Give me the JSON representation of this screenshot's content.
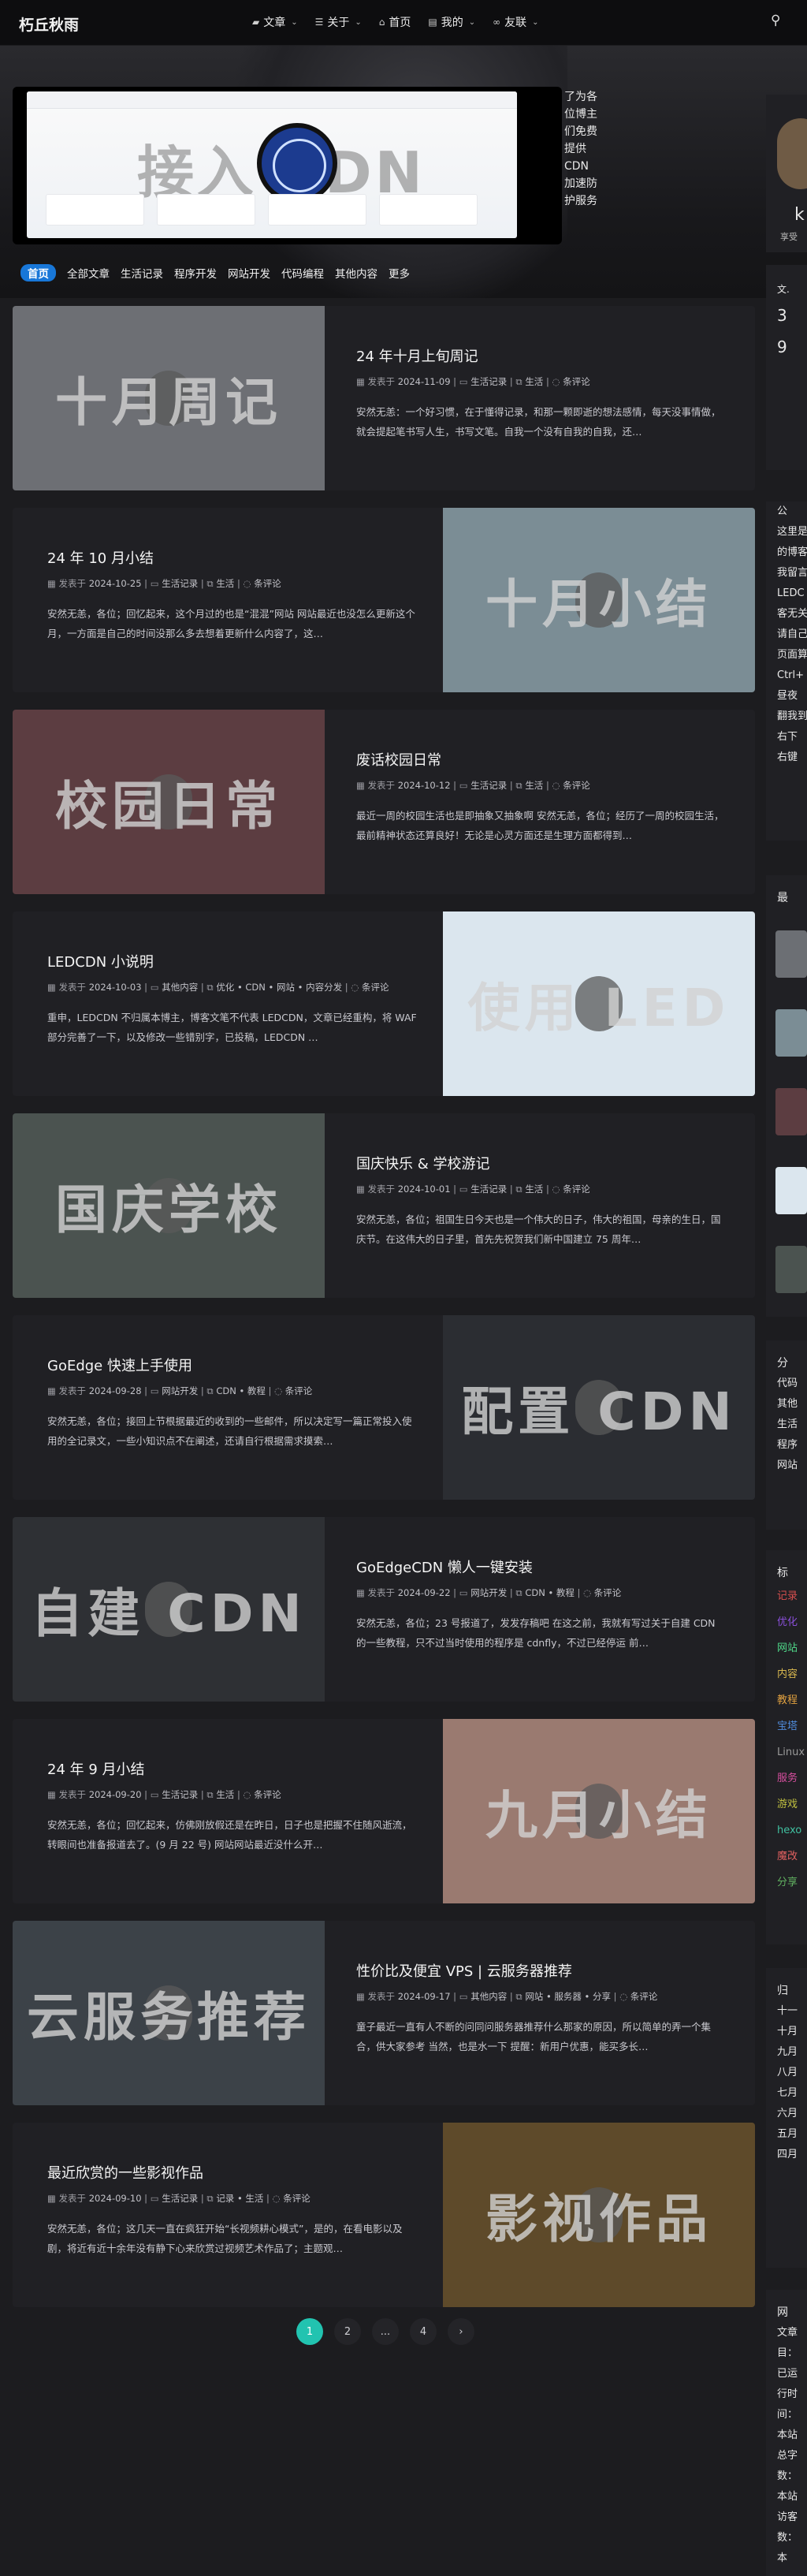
{
  "site": {
    "logo": "朽丘秋雨"
  },
  "nav": {
    "items": [
      {
        "label": "文章",
        "icon": "folder-icon",
        "glyph": "▰"
      },
      {
        "label": "关于",
        "icon": "list-icon",
        "glyph": "☰"
      },
      {
        "label": "首页",
        "icon": "home-icon",
        "glyph": "⌂"
      },
      {
        "label": "我的",
        "icon": "user-icon",
        "glyph": "▤"
      },
      {
        "label": "友联",
        "icon": "link-icon",
        "glyph": "∞"
      }
    ],
    "search_glyph": "⚲"
  },
  "banner": {
    "image_text": "接入 CDN",
    "side_text": "了为各位博主们免费提供 CDN 加速防护服务"
  },
  "categories": [
    {
      "label": "首页",
      "active": true
    },
    {
      "label": "全部文章"
    },
    {
      "label": "生活记录"
    },
    {
      "label": "程序开发"
    },
    {
      "label": "网站开发"
    },
    {
      "label": "代码编程"
    },
    {
      "label": "其他内容"
    },
    {
      "label": "更多"
    }
  ],
  "posts": [
    {
      "title": "24 年十月上旬周记",
      "date": "2024-11-09",
      "category": "生活记录",
      "tags": "生活",
      "comments": "条评论",
      "excerpt": "安然无恙：一个好习惯，在于懂得记录，和那一颗即逝的想法感情，每天没事情做，就会提起笔书写人生，书写文笔。自我一个没有自我的自我，还…",
      "thumb_text": "十月周记",
      "thumb_bg": "#6d6f74"
    },
    {
      "title": "24 年 10 月小结",
      "date": "2024-10-25",
      "category": "生活记录",
      "tags": "生活",
      "comments": "条评论",
      "excerpt": "安然无恙，各位；回忆起来，这个月过的也是“混混”网站 网站最近也没怎么更新这个月，一方面是自己的时间没那么多去想着更新什么内容了，这…",
      "thumb_text": "十月小结",
      "thumb_bg": "#7b8d95"
    },
    {
      "title": "废话校园日常",
      "date": "2024-10-12",
      "category": "生活记录",
      "tags": "生活",
      "comments": "条评论",
      "excerpt": "最近一周的校园生活也是即抽象又抽象啊 安然无恙，各位；经历了一周的校园生活，最前精神状态还算良好！无论是心灵方面还是生理方面都得到…",
      "thumb_text": "校园日常",
      "thumb_bg": "#5c3d41"
    },
    {
      "title": "LEDCDN 小说明",
      "date": "2024-10-03",
      "category": "其他内容",
      "tags": "优化 • CDN • 网站 • 内容分发",
      "comments": "条评论",
      "excerpt": "重申，LEDCDN 不归属本博主，博客文笔不代表 LEDCDN，文章已经重构，将 WAF 部分完善了一下，以及修改一些错别字，已投稿，LEDCDN …",
      "thumb_text": "使用 LED",
      "thumb_bg": "#dbe6ee"
    },
    {
      "title": "国庆快乐 & 学校游记",
      "date": "2024-10-01",
      "category": "生活记录",
      "tags": "生活",
      "comments": "条评论",
      "excerpt": "安然无恙，各位；祖国生日今天也是一个伟大的日子，伟大的祖国，母亲的生日，国庆节。在这伟大的日子里，首先先祝贺我们新中国建立 75 周年…",
      "thumb_text": "国庆学校",
      "thumb_bg": "#4b5350"
    },
    {
      "title": "GoEdge 快速上手使用",
      "date": "2024-09-28",
      "category": "网站开发",
      "tags": "CDN • 教程",
      "comments": "条评论",
      "excerpt": "安然无恙，各位；接回上节根据最近的收到的一些邮件，所以决定写一篇正常投入使用的全记录文，一些小知识点不在阐述，还请自行根据需求摸索…",
      "thumb_text": "配置 CDN",
      "thumb_bg": "#2b2d32"
    },
    {
      "title": "GoEdgeCDN 懒人一键安装",
      "date": "2024-09-22",
      "category": "网站开发",
      "tags": "CDN • 教程",
      "comments": "条评论",
      "excerpt": "安然无恙，各位；23 号报道了，发发存稿吧 在这之前，我就有写过关于自建 CDN 的一些教程，只不过当时使用的程序是 cdnfly，不过已经停运 前…",
      "thumb_text": "自建 CDN",
      "thumb_bg": "#2e3034"
    },
    {
      "title": "24 年 9 月小结",
      "date": "2024-09-20",
      "category": "生活记录",
      "tags": "生活",
      "comments": "条评论",
      "excerpt": "安然无恙，各位；回忆起来，仿佛刚放假还是在昨日，日子也是把握不住随风逝流，转眼间也准备报道去了。(9 月 22 号) 网站网站最近没什么开…",
      "thumb_text": "九月小结",
      "thumb_bg": "#9a7a70"
    },
    {
      "title": "性价比及便宜 VPS | 云服务器推荐",
      "date": "2024-09-17",
      "category": "其他内容",
      "tags": "网站 • 服务器 • 分享",
      "comments": "条评论",
      "excerpt": "童子最近一直有人不断的问同问服务器推荐什么那家的原因，所以简单的弄一个集合，供大家参考 当然，也是水一下 提醒：新用户优惠，能买多长…",
      "thumb_text": "云服务推荐",
      "thumb_bg": "#3c4248"
    },
    {
      "title": "最近欣赏的一些影视作品",
      "date": "2024-09-10",
      "category": "生活记录",
      "tags": "记录 • 生活",
      "comments": "条评论",
      "excerpt": "安然无恙，各位；这几天一直在疯狂开始“长视频耕心模式”，是的，在看电影以及剧，将近有近十余年没有静下心来欣赏过视频艺术作品了；主题观…",
      "thumb_text": "影视作品",
      "thumb_bg": "#5e4a2a"
    }
  ],
  "meta_labels": {
    "published": "发表于"
  },
  "pagination": [
    "1",
    "2",
    "...",
    "4",
    "›"
  ],
  "sidebar": {
    "profile": [
      "k",
      "享受"
    ],
    "stats": [
      "文.",
      "3",
      "9"
    ],
    "notice": [
      "公",
      "这里是",
      "的博客",
      "我留言",
      "LEDC",
      "客无关",
      "请自己",
      "页面算",
      "Ctrl+",
      "昼夜",
      "翻我到",
      "右下",
      "右键"
    ],
    "recent": "最",
    "categories": {
      "title": "分",
      "items": [
        "代码",
        "其他",
        "生活",
        "程序",
        "网站"
      ]
    },
    "tags": {
      "title": "标",
      "items": [
        "记录",
        "优化",
        "网站",
        "内容",
        "教程",
        "宝塔",
        "Linux",
        "服务",
        "游戏",
        "hexo",
        "魔改",
        "分享"
      ]
    },
    "archive": {
      "title": "归",
      "items": [
        "十一",
        "十月",
        "九月",
        "八月",
        "七月",
        "六月",
        "五月",
        "四月"
      ]
    },
    "info": {
      "title": "网",
      "items": [
        "文章",
        "目：",
        "已运",
        "行时",
        "间：",
        "本站",
        "总字",
        "数：",
        "本站",
        "访客",
        "数：",
        "本"
      ]
    }
  }
}
